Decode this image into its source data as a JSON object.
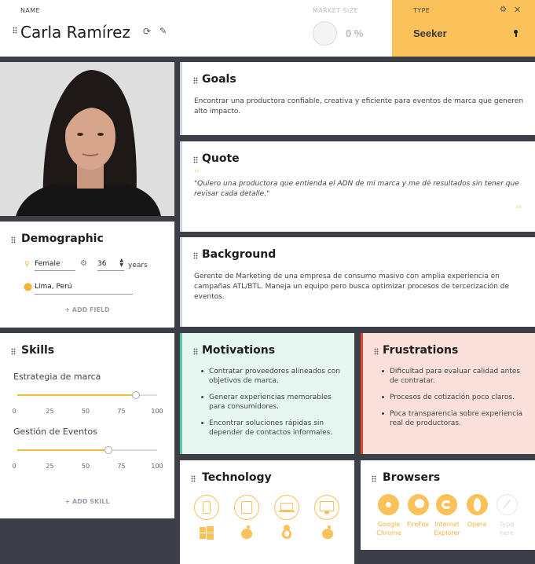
{
  "header": {
    "name_label": "NAME",
    "name": "Carla Ramírez",
    "market_label": "MARKET SIZE",
    "market_value": "0 %",
    "type_label": "TYPE",
    "type_value": "Seeker"
  },
  "goals": {
    "title": "Goals",
    "text": "Encontrar una productora confiable, creativa y eficiente para eventos de marca que generen alto impacto."
  },
  "quote": {
    "title": "Quote",
    "text": "\"Quiero una productora que entienda el ADN de mi marca y me dé resultados sin tener que revisar cada detalle.\""
  },
  "demographic": {
    "title": "Demographic",
    "gender": "Female",
    "age": "36",
    "age_unit": "years",
    "location": "Lima, Perú",
    "add_field": "+ ADD FIELD"
  },
  "background": {
    "title": "Background",
    "text": "Gerente de Marketing de una empresa de consumo masivo con amplia experiencia en campañas ATL/BTL. Maneja un equipo pero busca optimizar procesos de tercerización de eventos."
  },
  "skills": {
    "title": "Skills",
    "items": [
      {
        "label": "Estrategia de marca",
        "value": 85
      },
      {
        "label": "Gestión de Eventos",
        "value": 65
      }
    ],
    "ticks": [
      "0",
      "25",
      "50",
      "75",
      "100"
    ],
    "add_skill": "+ ADD SKILL"
  },
  "motivations": {
    "title": "Motivations",
    "color": "#e6f7f1",
    "items": [
      "Contratar proveedores alineados con objetivos de marca.",
      "Generar experiencias memorables para consumidores.",
      "Encontrar soluciones rápidas sin depender de contactos informales."
    ]
  },
  "frustrations": {
    "title": "Frustrations",
    "color": "#fbe0dc",
    "items": [
      "Dificultad para evaluar calidad antes de contratar.",
      "Procesos de cotización poco claros.",
      "Poca transparencia sobre experiencia real de productoras."
    ]
  },
  "technology": {
    "title": "Technology",
    "devices": [
      "mobile-icon",
      "tablet-icon",
      "laptop-icon",
      "desktop-icon"
    ],
    "os": [
      "windows-icon",
      "apple-icon",
      "linux-icon",
      "apple-icon"
    ]
  },
  "browsers": {
    "title": "Browsers",
    "items": [
      {
        "line1": "Google",
        "line2": "Chrome",
        "active": true
      },
      {
        "line1": "FireFox",
        "line2": "",
        "active": true
      },
      {
        "line1": "Internet",
        "line2": "Explorer",
        "active": true
      },
      {
        "line1": "Opera",
        "line2": "",
        "active": true
      },
      {
        "line1": "Type",
        "line2": "here",
        "active": false
      }
    ]
  },
  "colors": {
    "accent": "#fbc15a",
    "dark": "#3c3f46"
  }
}
